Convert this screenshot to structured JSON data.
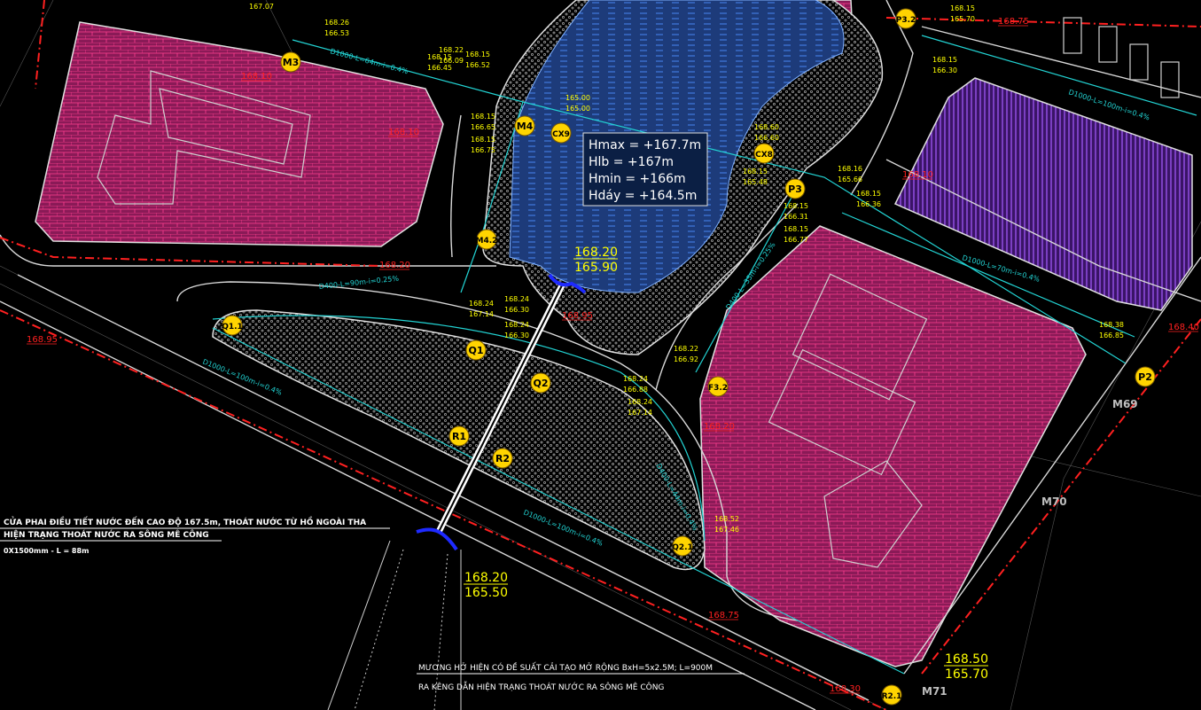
{
  "colors": {
    "background": "#000000",
    "lot_fill": "#8a1a57",
    "lot_brick": "#ff3d8f",
    "purple_lot": "#7a2fc7",
    "pond_fill": "#1d3b7a",
    "pond_dash": "#4a8cff",
    "road_edge": "#d9d9d9",
    "red_line": "#ff2020",
    "cyan": "#22d3d3",
    "yellow": "#ffff00",
    "marker": "#ffd400",
    "culvert": "#ffffff",
    "outlet": "#1e2aff"
  },
  "pond_info": {
    "hmax": "Hmax = +167.7m",
    "hlb": "Hlb    = +167m",
    "hmin": "Hmin  = +166m",
    "hday": "Hdáy  = +164.5m"
  },
  "culvert_top": {
    "top": "168.20",
    "bottom": "165.90"
  },
  "culvert_bottom": {
    "top": "168.20",
    "bottom": "165.50"
  },
  "corner_se": {
    "top": "168.50",
    "bottom": "165.70"
  },
  "nodes": [
    {
      "id": "m3",
      "label": "M3"
    },
    {
      "id": "m4",
      "label": "M4"
    },
    {
      "id": "cx9",
      "label": "CX9"
    },
    {
      "id": "m42",
      "label": "M4.2"
    },
    {
      "id": "q11",
      "label": "Q1.1"
    },
    {
      "id": "q1",
      "label": "Q1"
    },
    {
      "id": "q2",
      "label": "Q2"
    },
    {
      "id": "r1",
      "label": "R1"
    },
    {
      "id": "r2",
      "label": "R2"
    },
    {
      "id": "q21",
      "label": "Q2.1"
    },
    {
      "id": "f32",
      "label": "F3.2"
    },
    {
      "id": "p3",
      "label": "P3"
    },
    {
      "id": "cx8",
      "label": "CX8"
    },
    {
      "id": "p32",
      "label": "P3.2"
    },
    {
      "id": "p2",
      "label": "P2"
    },
    {
      "id": "r21",
      "label": "R2.1"
    }
  ],
  "manholes": [
    {
      "id": "m69",
      "label": "M69"
    },
    {
      "id": "m70",
      "label": "M70"
    },
    {
      "id": "m71",
      "label": "M71"
    }
  ],
  "level_tags": [
    {
      "id": "t1",
      "text": "168.10"
    },
    {
      "id": "t2",
      "text": "168.10"
    },
    {
      "id": "t3",
      "text": "168.10"
    },
    {
      "id": "t4",
      "text": "168.20"
    },
    {
      "id": "t5",
      "text": "168.95"
    },
    {
      "id": "t6",
      "text": "168.95"
    },
    {
      "id": "t7",
      "text": "168.20"
    },
    {
      "id": "t8",
      "text": "168.40"
    },
    {
      "id": "t9",
      "text": "168.75"
    },
    {
      "id": "t10",
      "text": "168.75"
    },
    {
      "id": "t11",
      "text": "168.30"
    }
  ],
  "small_labels": [
    {
      "id": "s1",
      "text": "168.26"
    },
    {
      "id": "s2",
      "text": "166.53"
    },
    {
      "id": "s3",
      "text": "168.22"
    },
    {
      "id": "s4",
      "text": "166.09"
    },
    {
      "id": "s5",
      "text": "168.15"
    },
    {
      "id": "s6",
      "text": "166.52"
    },
    {
      "id": "s7",
      "text": "168.15"
    },
    {
      "id": "s8",
      "text": "166.45"
    },
    {
      "id": "s9",
      "text": "165.00"
    },
    {
      "id": "s10",
      "text": "165.00"
    },
    {
      "id": "s11",
      "text": "168.15"
    },
    {
      "id": "s12",
      "text": "166.65"
    },
    {
      "id": "s13",
      "text": "168.15"
    },
    {
      "id": "s14",
      "text": "166.75"
    },
    {
      "id": "s15",
      "text": "168.24"
    },
    {
      "id": "s16",
      "text": "167.14"
    },
    {
      "id": "s17",
      "text": "168.24"
    },
    {
      "id": "s18",
      "text": "166.30"
    },
    {
      "id": "s19",
      "text": "168.24"
    },
    {
      "id": "s20",
      "text": "166.30"
    },
    {
      "id": "s21",
      "text": "168.24"
    },
    {
      "id": "s22",
      "text": "166.88"
    },
    {
      "id": "s23",
      "text": "168.24"
    },
    {
      "id": "s24",
      "text": "167.14"
    },
    {
      "id": "s25",
      "text": "168.22"
    },
    {
      "id": "s26",
      "text": "166.92"
    },
    {
      "id": "s27",
      "text": "168.52"
    },
    {
      "id": "s28",
      "text": "167.46"
    },
    {
      "id": "s29",
      "text": "168.15"
    },
    {
      "id": "s30",
      "text": "166.31"
    },
    {
      "id": "s31",
      "text": "168.15"
    },
    {
      "id": "s32",
      "text": "166.77"
    },
    {
      "id": "s33",
      "text": "168.16"
    },
    {
      "id": "s34",
      "text": "165.66"
    },
    {
      "id": "s35",
      "text": "168.15"
    },
    {
      "id": "s36",
      "text": "166.36"
    },
    {
      "id": "s37",
      "text": "168.15"
    },
    {
      "id": "s38",
      "text": "165.48"
    },
    {
      "id": "s39",
      "text": "168.60"
    },
    {
      "id": "s40",
      "text": "166.60"
    },
    {
      "id": "s41",
      "text": "168.15"
    },
    {
      "id": "s42",
      "text": "165.70"
    },
    {
      "id": "s43",
      "text": "168.15"
    },
    {
      "id": "s44",
      "text": "166.30"
    },
    {
      "id": "s45",
      "text": "168.38"
    },
    {
      "id": "s46",
      "text": "166.85"
    },
    {
      "id": "s47",
      "text": "167.07"
    }
  ],
  "pipe_labels": [
    {
      "id": "pl1",
      "text": "D1000-L=64m-i=0.4%"
    },
    {
      "id": "pl2",
      "text": "D400-L=90m-i=0.25%"
    },
    {
      "id": "pl3",
      "text": "D1000-L=100m-i=0.4%"
    },
    {
      "id": "pl4",
      "text": "D400-L=44m-i=0.4%"
    },
    {
      "id": "pl5",
      "text": "D1000-L=70m-i=0.4%"
    },
    {
      "id": "pl6",
      "text": "D1000-L=100m-i=0.4%"
    },
    {
      "id": "pl7",
      "text": "D400-L=35m-i=0.25%"
    },
    {
      "id": "pl8",
      "text": "D1000-L=100m-i=0.4%"
    }
  ],
  "notes": {
    "line1": "CỬA PHAI ĐIỀU TIẾT NƯỚC ĐẾN CAO ĐỘ 167.5m, THOÁT NƯỚC TỪ HỒ NGOÀI THA",
    "line2": "HIỆN TRẠNG THOÁT NƯỚC RA SÔNG MÊ CÔNG",
    "line3": "0X1500mm - L = 88m",
    "canal1": "MƯƠNG HỞ HIỆN CÓ ĐỀ SUẤT CẢI TẠO MỞ RỘNG BxH=5x2.5M; L=900M",
    "canal2": "RA KÊNG DẪN HIỆN TRẠNG THOÁT NƯỚC RA SÔNG MÊ CÔNG"
  }
}
